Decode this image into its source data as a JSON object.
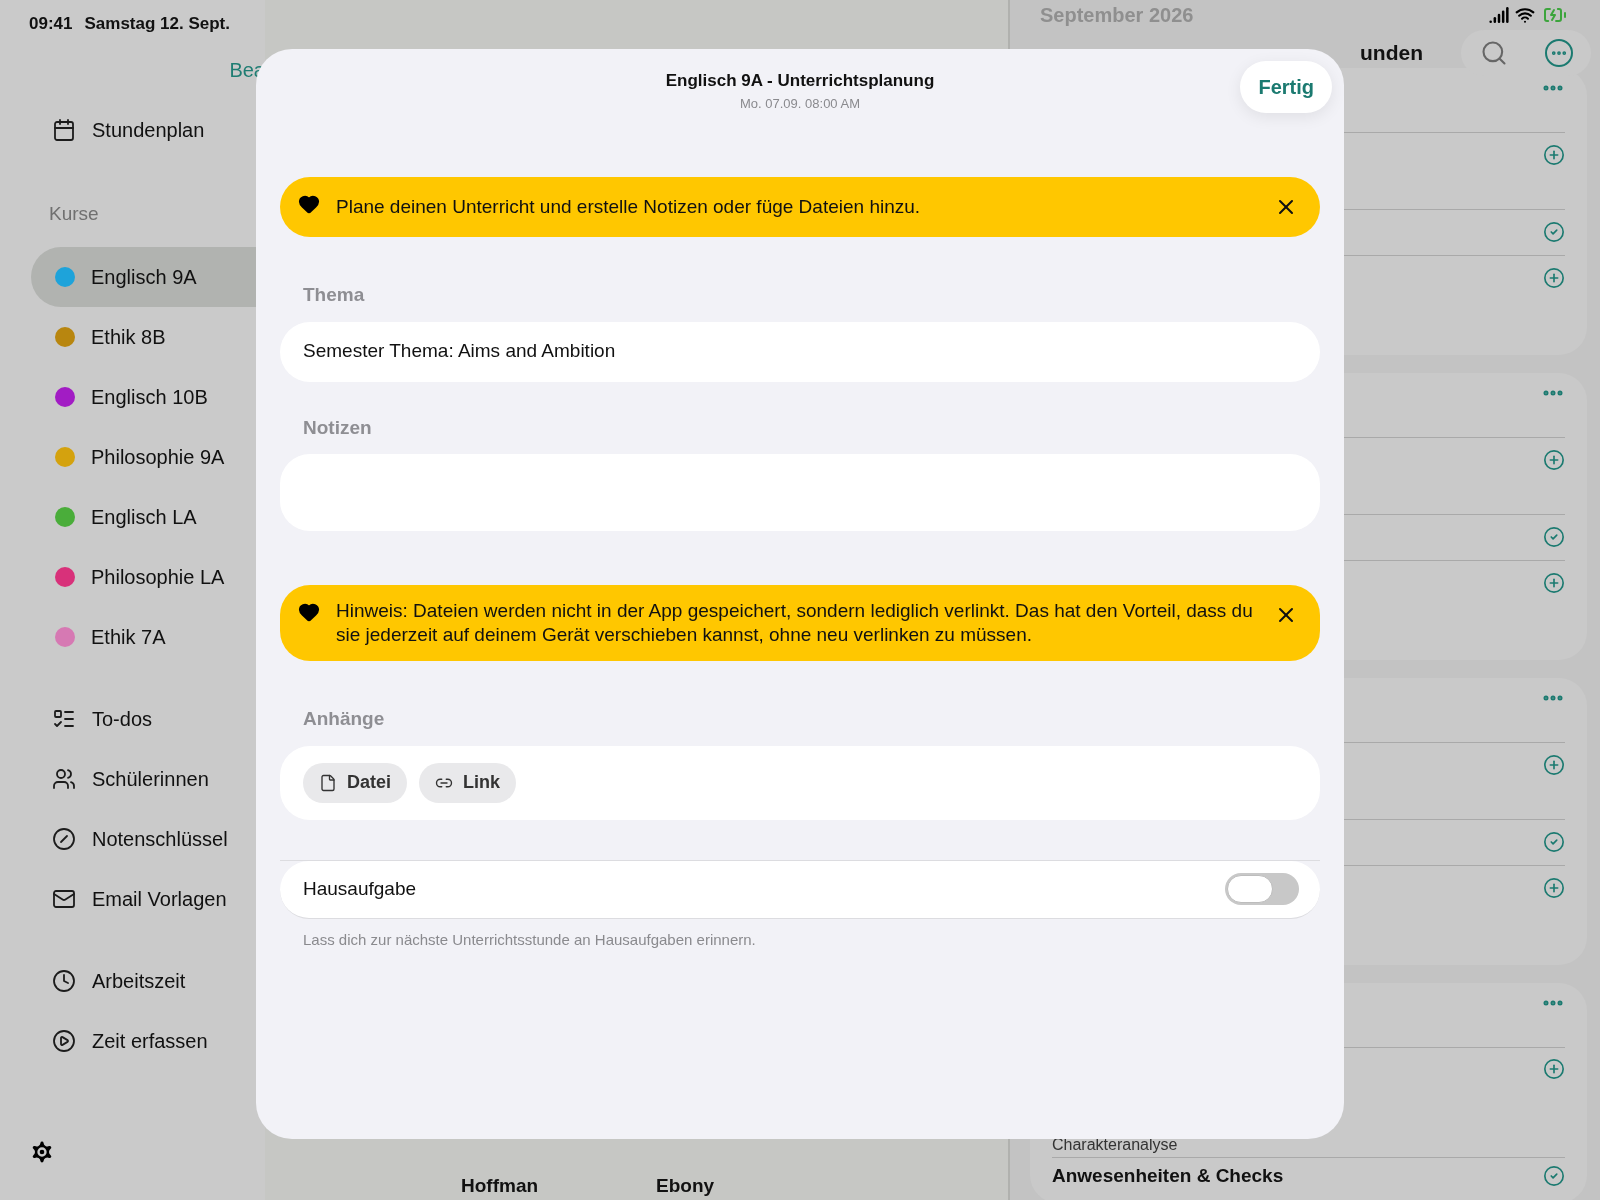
{
  "status_bar": {
    "time": "09:41",
    "date": "Samstag 12. Sept."
  },
  "sidebar": {
    "edit_link": "Bea",
    "schedule": "Stundenplan",
    "section_title": "Kurse",
    "courses": [
      {
        "name": "Englisch 9A",
        "color": "#1ea3da",
        "selected": true
      },
      {
        "name": "Ethik 8B",
        "color": "#b8860f",
        "selected": false
      },
      {
        "name": "Englisch 10B",
        "color": "#a21cc4",
        "selected": false
      },
      {
        "name": "Philosophie 9A",
        "color": "#d4a20e",
        "selected": false
      },
      {
        "name": "Englisch LA",
        "color": "#4aad3a",
        "selected": false
      },
      {
        "name": "Philosophie LA",
        "color": "#d8317a",
        "selected": false
      },
      {
        "name": "Ethik 7A",
        "color": "#d679b3",
        "selected": false
      }
    ],
    "tools": [
      {
        "kind": "todo",
        "label": "To-dos"
      },
      {
        "kind": "people",
        "label": "Schülerinnen"
      },
      {
        "kind": "grades",
        "label": "Notenschlüssel"
      },
      {
        "kind": "mail",
        "label": "Email Vorlagen"
      }
    ],
    "time_items": [
      {
        "kind": "clock",
        "label": "Arbeitszeit"
      },
      {
        "kind": "play",
        "label": "Zeit erfassen"
      }
    ]
  },
  "middle": {
    "names": [
      "Hoffman",
      "Ebony"
    ]
  },
  "right_panel": {
    "month": "September 2026",
    "title": "unden",
    "cards": [
      {
        "rows": [
          {
            "kind": "plus"
          },
          {
            "kind": "check"
          },
          {
            "kind": "plus"
          }
        ]
      },
      {
        "rows": [
          {
            "kind": "plus"
          },
          {
            "kind": "check"
          },
          {
            "kind": "plus"
          }
        ]
      },
      {
        "rows": [
          {
            "kind": "plus"
          },
          {
            "kind": "check"
          },
          {
            "kind": "plus"
          }
        ]
      },
      {
        "rows": [
          {
            "kind": "plus",
            "text": "Charakteranalyse"
          },
          {
            "kind": "check",
            "text": "Anwesenheiten & Checks"
          }
        ]
      }
    ]
  },
  "modal": {
    "title": "Englisch 9A - Unterrichtsplanung",
    "subtitle": "Mo. 07.09. 08:00 AM",
    "done_button": "Fertig",
    "tip": "Plane deinen Unterricht und erstelle Notizen oder füge Dateien hinzu.",
    "topic_label": "Thema",
    "topic_value": "Semester Thema: Aims and Ambition",
    "notes_label": "Notizen",
    "notice": "Hinweis: Dateien werden nicht in der App gespeichert, sondern lediglich verlinkt. Das hat den Vorteil, dass du sie jederzeit auf deinem Gerät verschieben kannst, ohne neu verlinken zu müssen.",
    "attachments_label": "Anhänge",
    "attachment_buttons": [
      {
        "kind": "file",
        "label": "Datei"
      },
      {
        "kind": "link",
        "label": "Link"
      }
    ],
    "homework": {
      "label": "Hausaufgabe",
      "on": false,
      "hint": "Lass dich zur nächste Unterrichtsstunde an Hausaufgaben erinnern."
    }
  }
}
